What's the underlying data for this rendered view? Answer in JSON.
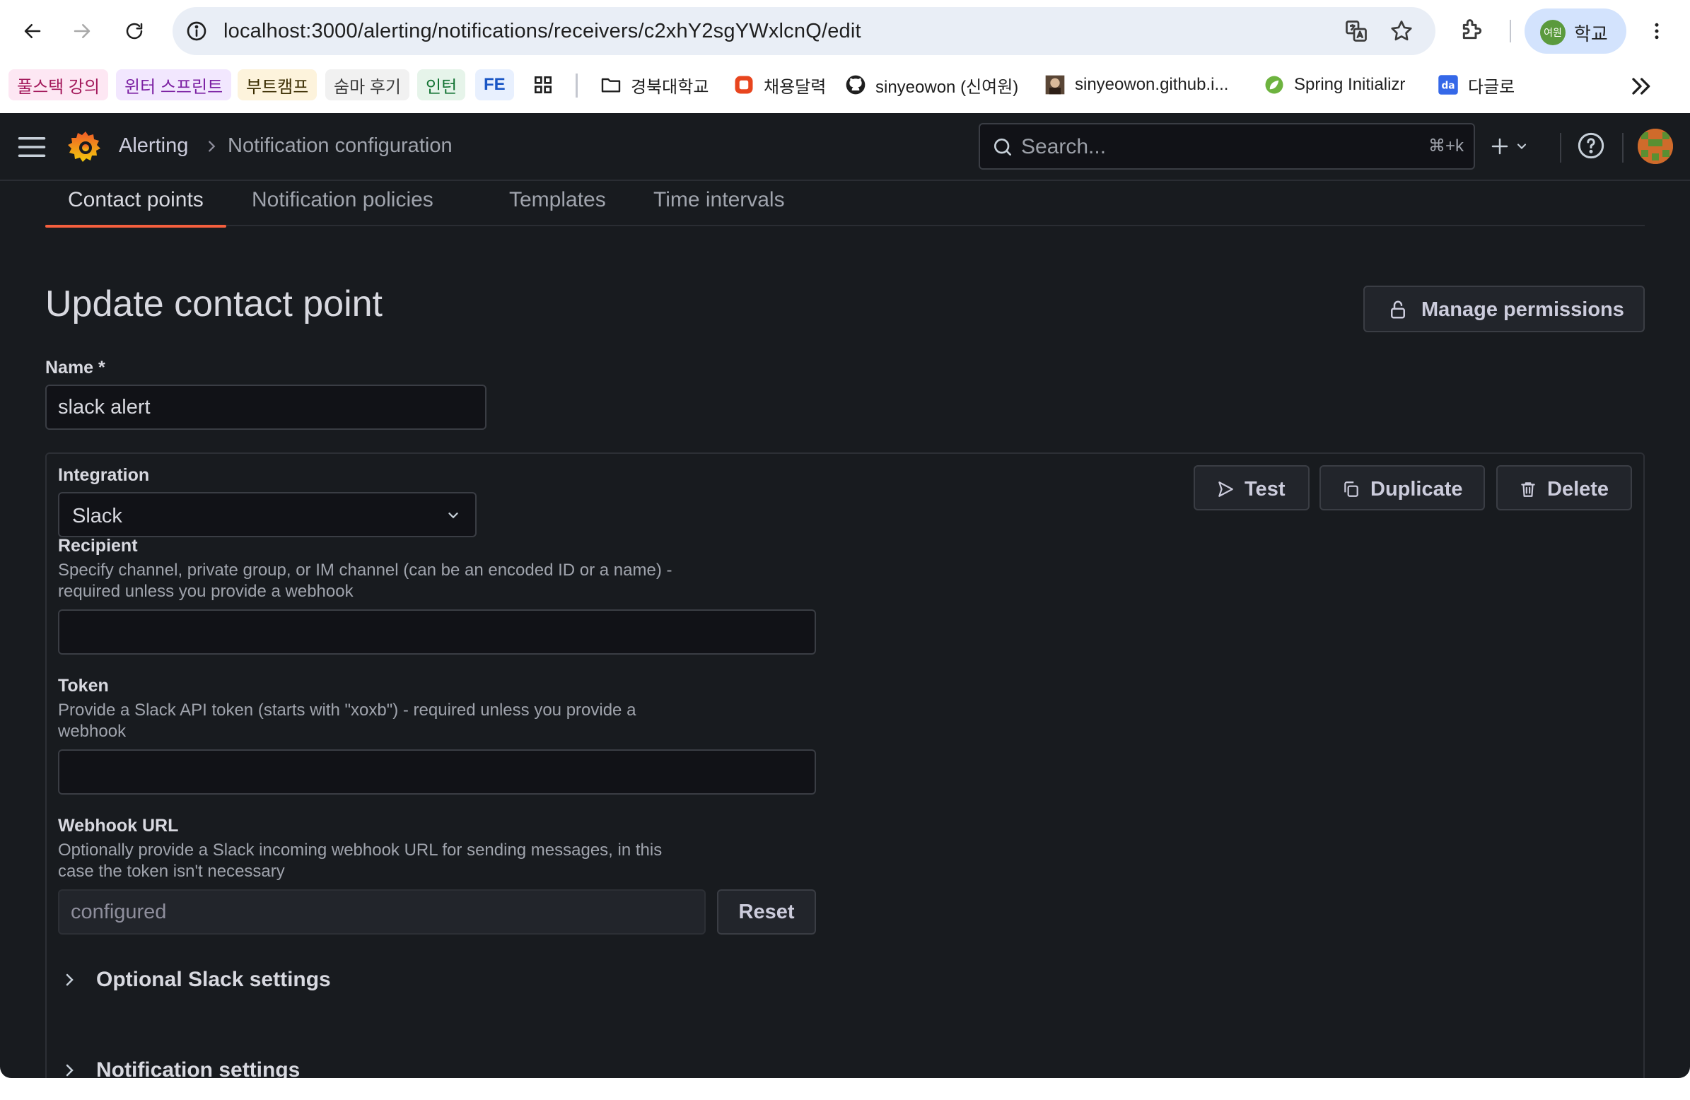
{
  "browser": {
    "url": "localhost:3000/alerting/notifications/receivers/c2xhY2sgYWxlcnQ/edit",
    "profile_initials": "여원",
    "profile_label": "학교",
    "bookmarks": [
      {
        "label": "풀스택 강의",
        "color": "#fde7f3",
        "text_color": "#a3195b"
      },
      {
        "label": "윈터 스프린트",
        "color": "#f2e7fe",
        "text_color": "#7b1fa2"
      },
      {
        "label": "부트캠프",
        "color": "#fdf3dc",
        "text_color": "#3a2c00"
      },
      {
        "label": "숨마 후기",
        "color": "#f1f1f1",
        "text_color": "#3c3c3c"
      },
      {
        "label": "인턴",
        "color": "#e6f4ea",
        "text_color": "#137333"
      },
      {
        "label": "FE",
        "color": "#e8f0fe",
        "text_color": "#1a56c5"
      },
      {
        "label": "경북대학교"
      },
      {
        "label": "채용달력"
      },
      {
        "label": "sinyeowon (신여원)"
      },
      {
        "label": "sinyeowon.github.i..."
      },
      {
        "label": "Spring Initializr"
      },
      {
        "label": "다글로"
      }
    ]
  },
  "topnav": {
    "breadcrumb_root": "Alerting",
    "breadcrumb_current": "Notification configuration",
    "search_placeholder": "Search...",
    "search_shortcut": "⌘+k"
  },
  "tabs": [
    {
      "label": "Contact points",
      "active": true
    },
    {
      "label": "Notification policies",
      "active": false
    },
    {
      "label": "Templates",
      "active": false
    },
    {
      "label": "Time intervals",
      "active": false
    }
  ],
  "page": {
    "title": "Update contact point",
    "manage_permissions": "Manage permissions",
    "name_label": "Name *",
    "name_value": "slack alert"
  },
  "integration": {
    "label": "Integration",
    "selected": "Slack",
    "buttons": {
      "test": "Test",
      "duplicate": "Duplicate",
      "delete": "Delete"
    },
    "recipient": {
      "label": "Recipient",
      "desc_line1": "Specify channel, private group, or IM channel (can be an encoded ID or a name) -",
      "desc_line2": "required unless you provide a webhook",
      "value": ""
    },
    "token": {
      "label": "Token",
      "desc_line1": "Provide a Slack API token (starts with \"xoxb\") - required unless you provide a",
      "desc_line2": "webhook",
      "value": ""
    },
    "webhook": {
      "label": "Webhook URL",
      "desc_line1": "Optionally provide a Slack incoming webhook URL for sending messages, in this",
      "desc_line2": "case the token isn't necessary",
      "placeholder": "configured",
      "reset": "Reset"
    },
    "optional_settings": "Optional Slack settings",
    "notification_settings": "Notification settings"
  },
  "colors": {
    "accent": "#f55f3e",
    "background": "#181b1f",
    "input_bg": "#111217"
  }
}
